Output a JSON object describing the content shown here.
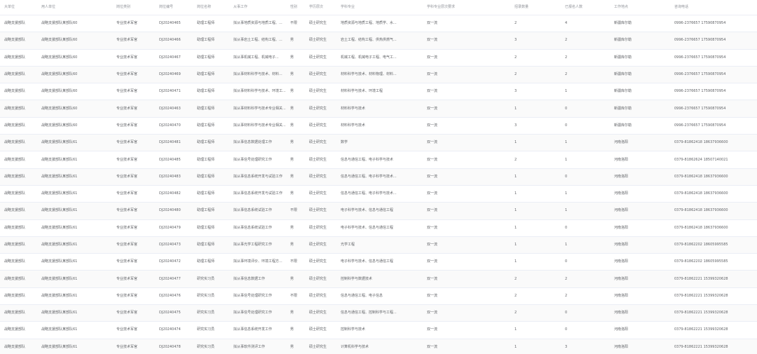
{
  "columns": [
    "大单位",
    "用人单位",
    "岗位类别",
    "岗位编号",
    "岗位名称",
    "从事工作",
    "性别",
    "学历层次",
    "学科专业",
    "学科专业层次要求",
    "招录数量",
    "已报名人数",
    "工作地点",
    "咨询电话"
  ],
  "rows": [
    [
      "战略支援部队",
      "战略支援部队某部队60",
      "专业技术军官",
      "DJ20240465",
      "助理工程师",
      "拟从事地质资源与地质工程、...",
      "不限",
      "硕士研究生",
      "地质资源与地质工程、地质学、水...",
      "双一流",
      "2",
      "4",
      "新疆库尔勒",
      "0996-2376657 17590870954"
    ],
    [
      "战略支援部队",
      "战略支援部队某部队60",
      "专业技术军官",
      "DJ20240466",
      "助理工程师",
      "拟从事岩土工程、结构工程、...",
      "男",
      "硕士研究生",
      "岩土工程、结构工程、供热供燃气...",
      "双一流",
      "3",
      "2",
      "新疆库尔勒",
      "0996-2376657 17590870954"
    ],
    [
      "战略支援部队",
      "战略支援部队某部队60",
      "专业技术军官",
      "DJ20240467",
      "助理工程师",
      "拟从事机械工程、机械电子...",
      "男",
      "硕士研究生",
      "机械工程、机械电子工程、电气工...",
      "双一流",
      "2",
      "2",
      "新疆库尔勒",
      "0996-2376657 17590870954"
    ],
    [
      "战略支援部队",
      "战略支援部队某部队60",
      "专业技术军官",
      "DJ20240469",
      "助理工程师",
      "拟从事材料科学与技术、材料...",
      "男",
      "硕士研究生",
      "材料科学与技术、材料物理、材料...",
      "双一流",
      "2",
      "2",
      "新疆库尔勒",
      "0996-2376657 17590870954"
    ],
    [
      "战略支援部队",
      "战略支援部队某部队60",
      "专业技术军官",
      "DJ20240471",
      "助理工程师",
      "拟从事材料科学与技术、环境工...",
      "男",
      "硕士研究生",
      "材料科学与技术、环境工程",
      "双一流",
      "3",
      "1",
      "新疆库尔勒",
      "0996-2376657 17590870954"
    ],
    [
      "战略支援部队",
      "战略支援部队某部队60",
      "专业技术军官",
      "DJ20240463",
      "助理工程师",
      "拟从事材料科学与技术专业相关...",
      "男",
      "硕士研究生",
      "材料科学与技术",
      "双一流",
      "1",
      "0",
      "新疆库尔勒",
      "0996-2376657 17590870954"
    ],
    [
      "战略支援部队",
      "战略支援部队某部队60",
      "专业技术军官",
      "DJ20240470",
      "助理工程师",
      "拟从事材料科学与技术专业相关...",
      "男",
      "硕士研究生",
      "材料科学与技术",
      "双一流",
      "3",
      "0",
      "新疆库尔勒",
      "0996-2376657 17590870954"
    ],
    [
      "战略支援部队",
      "战略支援部队某部队61",
      "专业技术军官",
      "DJ20240481",
      "助理工程师",
      "拟从事信息数据处理工作",
      "男",
      "硕士研究生",
      "数学",
      "双一流",
      "1",
      "1",
      "河南洛阳",
      "0379-81862418 18637936600"
    ],
    [
      "战略支援部队",
      "战略支援部队某部队61",
      "专业技术军官",
      "DJ20240485",
      "助理工程师",
      "拟从事信号处理研究工作",
      "男",
      "硕士研究生",
      "信息与通信工程、电子科学与技术",
      "双一流",
      "2",
      "1",
      "河南洛阳",
      "0379-81862624 18507140021"
    ],
    [
      "战略支援部队",
      "战略支援部队某部队61",
      "专业技术军官",
      "DJ20240483",
      "助理工程师",
      "拟从事信息系统开发与试验工作",
      "男",
      "硕士研究生",
      "信息与通信工程、电子科学与技术...",
      "双一流",
      "1",
      "0",
      "河南洛阳",
      "0379-81862418 18637936600"
    ],
    [
      "战略支援部队",
      "战略支援部队某部队61",
      "专业技术军官",
      "DJ20240482",
      "助理工程师",
      "拟从事信息系统开发与试验工作",
      "男",
      "硕士研究生",
      "信息与通信工程、电子科学与技术...",
      "双一流",
      "1",
      "1",
      "河南洛阳",
      "0379-81862418 18637936600"
    ],
    [
      "战略支援部队",
      "战略支援部队某部队61",
      "专业技术军官",
      "DJ20240480",
      "助理工程师",
      "拟从事信息系统试验工作",
      "不限",
      "硕士研究生",
      "电子科学与技术、信息与通信工程",
      "双一流",
      "1",
      "1",
      "河南洛阳",
      "0379-81862418 18637936600"
    ],
    [
      "战略支援部队",
      "战略支援部队某部队61",
      "专业技术军官",
      "DJ20240479",
      "助理工程师",
      "拟从事信息系统试验工作",
      "男",
      "硕士研究生",
      "电子科学与技术、信息与通信工程",
      "双一流",
      "1",
      "0",
      "河南洛阳",
      "0379-81862418 18637936600"
    ],
    [
      "战略支援部队",
      "战略支援部队某部队61",
      "专业技术军官",
      "DJ20240473",
      "助理工程师",
      "拟从事光学工程研究工作",
      "男",
      "硕士研究生",
      "光学工程",
      "双一流",
      "1",
      "1",
      "河南洛阳",
      "0379-81862202 18605995585"
    ],
    [
      "战略支援部队",
      "战略支援部队某部队61",
      "专业技术军官",
      "DJ20240472",
      "助理工程师",
      "拟从事环境评价、环境工程方...",
      "不限",
      "硕士研究生",
      "电子科学与技术、信息与通信工程",
      "双一流",
      "1",
      "0",
      "河南洛阳",
      "0379-81862202 18605995585"
    ],
    [
      "战略支援部队",
      "战略支援部队某部队61",
      "专业技术军官",
      "DJ20240477",
      "研究实习员",
      "拟从事信息数据工作",
      "男",
      "硕士研究生",
      "控制科学与数据技术",
      "双一流",
      "2",
      "2",
      "河南洛阳",
      "0379-81862221 15399320628"
    ],
    [
      "战略支援部队",
      "战略支援部队某部队61",
      "专业技术军官",
      "DJ20240476",
      "研究实习员",
      "拟从事信号处理研究工作",
      "不限",
      "硕士研究生",
      "信息与通信工程、电子信息",
      "双一流",
      "2",
      "2",
      "河南洛阳",
      "0379-81862221 15399320628"
    ],
    [
      "战略支援部队",
      "战略支援部队某部队61",
      "专业技术军官",
      "DJ20240475",
      "研究实习员",
      "拟从事信号处理研究工作",
      "男",
      "硕士研究生",
      "信息与通信工程、控制科学与工程...",
      "双一流",
      "2",
      "0",
      "河南洛阳",
      "0379-81862221 15399320628"
    ],
    [
      "战略支援部队",
      "战略支援部队某部队61",
      "专业技术军官",
      "DJ20240474",
      "研究实习员",
      "拟从事信息系统开发工作",
      "男",
      "硕士研究生",
      "控制科学与技术",
      "双一流",
      "1",
      "0",
      "河南洛阳",
      "0379-81862221 15399320628"
    ],
    [
      "战略支援部队",
      "战略支援部队某部队61",
      "专业技术军官",
      "DJ20240478",
      "研究实习员",
      "拟从事软件测评工作",
      "男",
      "硕士研究生",
      "计算机科学与技术",
      "双一流",
      "1",
      "3",
      "河南洛阳",
      "0379-81862221 15399320628"
    ]
  ]
}
